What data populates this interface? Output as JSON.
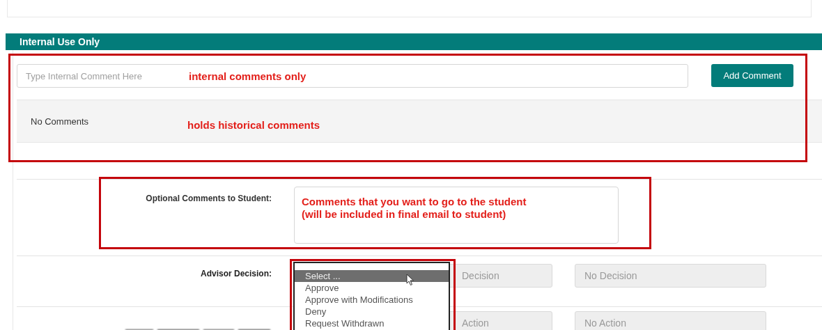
{
  "header": {
    "title": "Internal Use Only"
  },
  "internal_comment": {
    "placeholder": "Type Internal Comment Here",
    "button": "Add Comment",
    "history": "No Comments"
  },
  "form_rows": [
    {
      "kind": "textarea",
      "label": "Optional Comments to Student:"
    },
    {
      "kind": "fields",
      "label": "Advisor Decision:",
      "fields": [
        "Decision",
        "No Decision"
      ]
    },
    {
      "kind": "fields",
      "fields": [
        "Action",
        "No Action"
      ]
    }
  ],
  "dropdown": {
    "options": [
      {
        "label": "Select ...",
        "selected": true
      },
      {
        "label": "Approve",
        "selected": false
      },
      {
        "label": "Approve with Modifications",
        "selected": false
      },
      {
        "label": "Deny",
        "selected": false
      },
      {
        "label": "Request Withdrawn",
        "selected": false
      }
    ]
  },
  "annotations": [
    {
      "lines": [
        "internal comments only"
      ]
    },
    {
      "lines": [
        "holds historical comments"
      ]
    },
    {
      "lines": [
        "Comments that you want to go to the student",
        "(will be included in final email to student)"
      ]
    }
  ]
}
